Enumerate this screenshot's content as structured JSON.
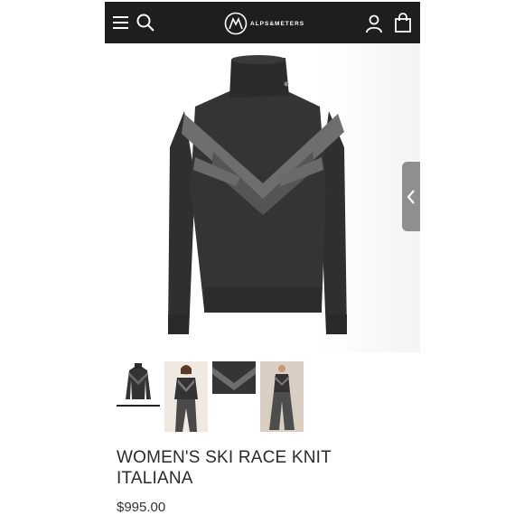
{
  "header": {
    "brand": "ALPS&METERS",
    "icons": [
      "menu-icon",
      "search-icon",
      "logo-icon",
      "account-icon",
      "shopping-bag-icon"
    ],
    "background": "#1e1e1e"
  },
  "gallery": {
    "main_image": "knit-sweater-photo",
    "thumbnails": [
      "sweater-front",
      "model-front",
      "sweater-detail",
      "model-full"
    ],
    "selected_index": 0,
    "side_tab_icon": "chevron-left-icon"
  },
  "product": {
    "title": "WOMEN'S SKI RACE KNIT ITALIANA",
    "price": "$995.00"
  }
}
